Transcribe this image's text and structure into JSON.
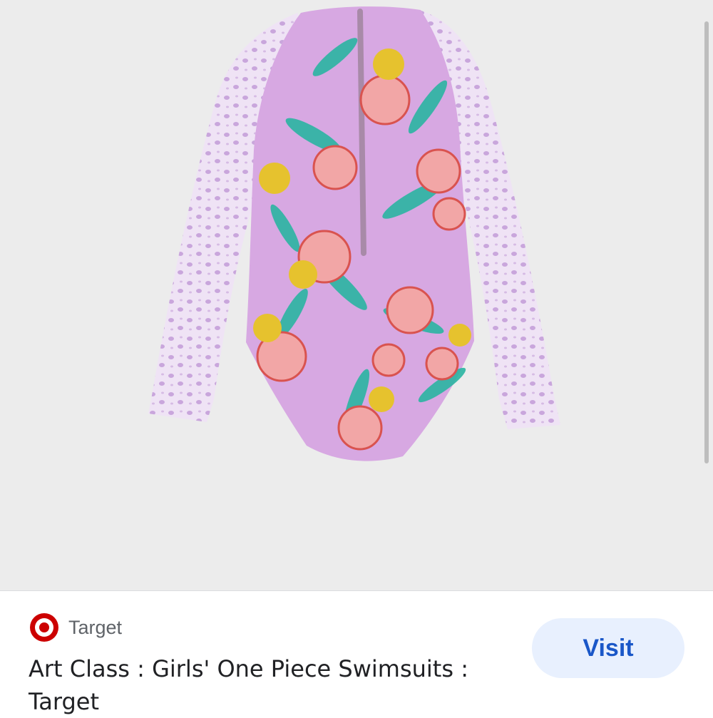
{
  "product_image": {
    "alt": "Girls' long sleeve floral one piece swimsuit, back view",
    "icon": "swimsuit-image"
  },
  "source": {
    "name": "Target",
    "logo_icon": "target-bullseye-icon",
    "brand_color": "#cc0000"
  },
  "result": {
    "title": "Art Class : Girls' One Piece Swimsuits : Target"
  },
  "visit_button": {
    "label": "Visit",
    "color": "#1a57c8",
    "background": "#e8f0fe"
  }
}
